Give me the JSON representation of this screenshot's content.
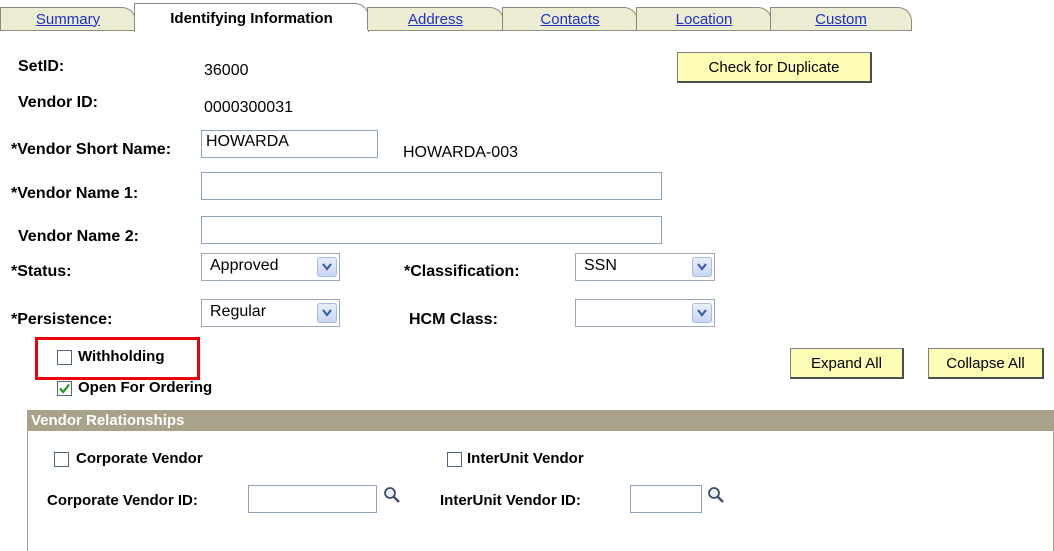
{
  "tabs": [
    {
      "label": "Summary",
      "active": false
    },
    {
      "label": "Identifying Information",
      "active": true
    },
    {
      "label": "Address",
      "active": false
    },
    {
      "label": "Contacts",
      "active": false
    },
    {
      "label": "Location",
      "active": false
    },
    {
      "label": "Custom",
      "active": false
    }
  ],
  "form": {
    "setid_label": "SetID:",
    "setid_value": "36000",
    "vendor_id_label": "Vendor ID:",
    "vendor_id_value": "0000300031",
    "short_name_label": "*Vendor Short Name:",
    "short_name_value": "HOWARDA",
    "short_name_suffix": "HOWARDA-003",
    "name1_label": "*Vendor Name 1:",
    "name1_value": "",
    "name2_label": "Vendor Name 2:",
    "name2_value": "",
    "status_label": "*Status:",
    "status_value": "Approved",
    "classification_label": "*Classification:",
    "classification_value": "SSN",
    "persistence_label": "*Persistence:",
    "persistence_value": "Regular",
    "hcm_class_label": "HCM Class:",
    "hcm_class_value": "",
    "withholding_label": "Withholding",
    "withholding_checked": false,
    "open_for_ordering_label": "Open For Ordering",
    "open_for_ordering_checked": true
  },
  "buttons": {
    "check_duplicate": "Check for Duplicate",
    "expand_all": "Expand All",
    "collapse_all": "Collapse All"
  },
  "vendor_relationships": {
    "title": "Vendor Relationships",
    "corporate_vendor_label": "Corporate Vendor",
    "corporate_vendor_checked": false,
    "interunit_vendor_label": "InterUnit Vendor",
    "interunit_vendor_checked": false,
    "corporate_vendor_id_label": "Corporate Vendor ID:",
    "corporate_vendor_id_value": "",
    "interunit_vendor_id_label": "InterUnit Vendor ID:",
    "interunit_vendor_id_value": ""
  },
  "colors": {
    "tab_bg": "#ececd2",
    "link": "#1f31c9",
    "button_bg": "#fcfcb4",
    "section_bar": "#a8a28a",
    "highlight": "#e8000d"
  }
}
